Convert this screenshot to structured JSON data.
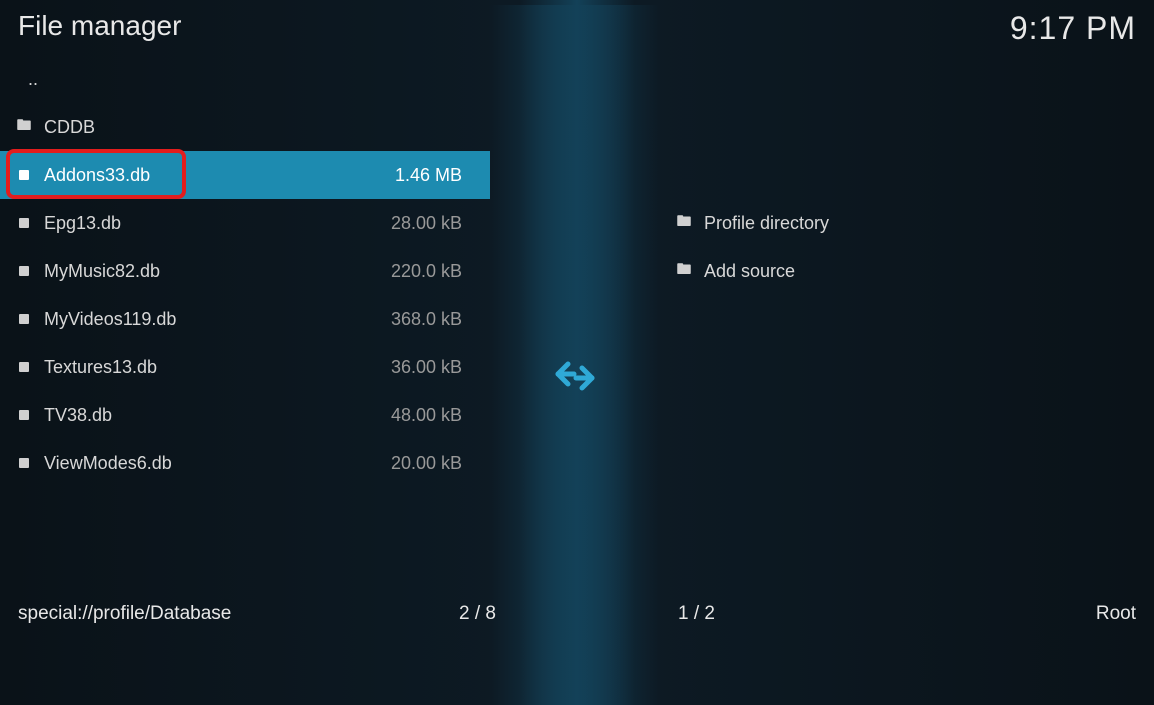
{
  "header": {
    "title": "File manager",
    "clock": "9:17 PM"
  },
  "left_panel": {
    "parent": "..",
    "items": [
      {
        "type": "folder",
        "name": "CDDB",
        "size": "",
        "selected": false
      },
      {
        "type": "file",
        "name": "Addons33.db",
        "size": "1.46 MB",
        "selected": true,
        "highlighted": true
      },
      {
        "type": "file",
        "name": "Epg13.db",
        "size": "28.00 kB",
        "selected": false
      },
      {
        "type": "file",
        "name": "MyMusic82.db",
        "size": "220.0 kB",
        "selected": false
      },
      {
        "type": "file",
        "name": "MyVideos119.db",
        "size": "368.0 kB",
        "selected": false
      },
      {
        "type": "file",
        "name": "Textures13.db",
        "size": "36.00 kB",
        "selected": false
      },
      {
        "type": "file",
        "name": "TV38.db",
        "size": "48.00 kB",
        "selected": false
      },
      {
        "type": "file",
        "name": "ViewModes6.db",
        "size": "20.00 kB",
        "selected": false
      }
    ]
  },
  "right_panel": {
    "items": [
      {
        "type": "folder",
        "name": "Profile directory"
      },
      {
        "type": "folder",
        "name": "Add source"
      }
    ]
  },
  "footer": {
    "left_path": "special://profile/Database",
    "left_count": "2 / 8",
    "right_count": "1 / 2",
    "right_label": "Root"
  }
}
